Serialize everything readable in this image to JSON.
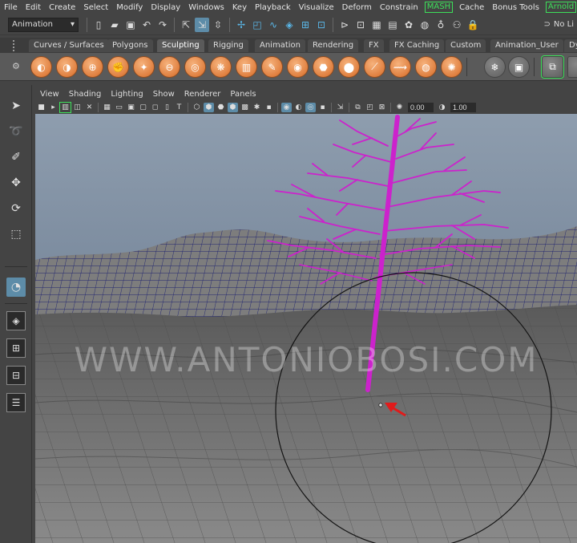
{
  "menubar": {
    "items": [
      "File",
      "Edit",
      "Create",
      "Select",
      "Modify",
      "Display",
      "Windows",
      "Key",
      "Playback",
      "Visualize",
      "Deform",
      "Constrain",
      "MASH",
      "Cache",
      "Bonus Tools",
      "Arnold"
    ]
  },
  "statusline": {
    "menuset": "Animation",
    "nolive": "No Li"
  },
  "shelf_tabs": [
    "Curves / Surfaces",
    "Polygons",
    "Sculpting",
    "Rigging",
    "Animation",
    "Rendering",
    "FX",
    "FX Caching",
    "Custom",
    "Animation_User",
    "Dy"
  ],
  "shelf_active_tab": "Sculpting",
  "viewport": {
    "menu": [
      "View",
      "Shading",
      "Lighting",
      "Show",
      "Renderer",
      "Panels"
    ],
    "field_1": "0.00",
    "field_2": "1.00"
  },
  "watermark": "WWW.ANTONIOBOSI.COM",
  "colors": {
    "accent_blue": "#5d8ca8",
    "arnold_green": "#3de05a",
    "tree_magenta": "#cc22cc",
    "sculpt_orange": "#e08040"
  }
}
